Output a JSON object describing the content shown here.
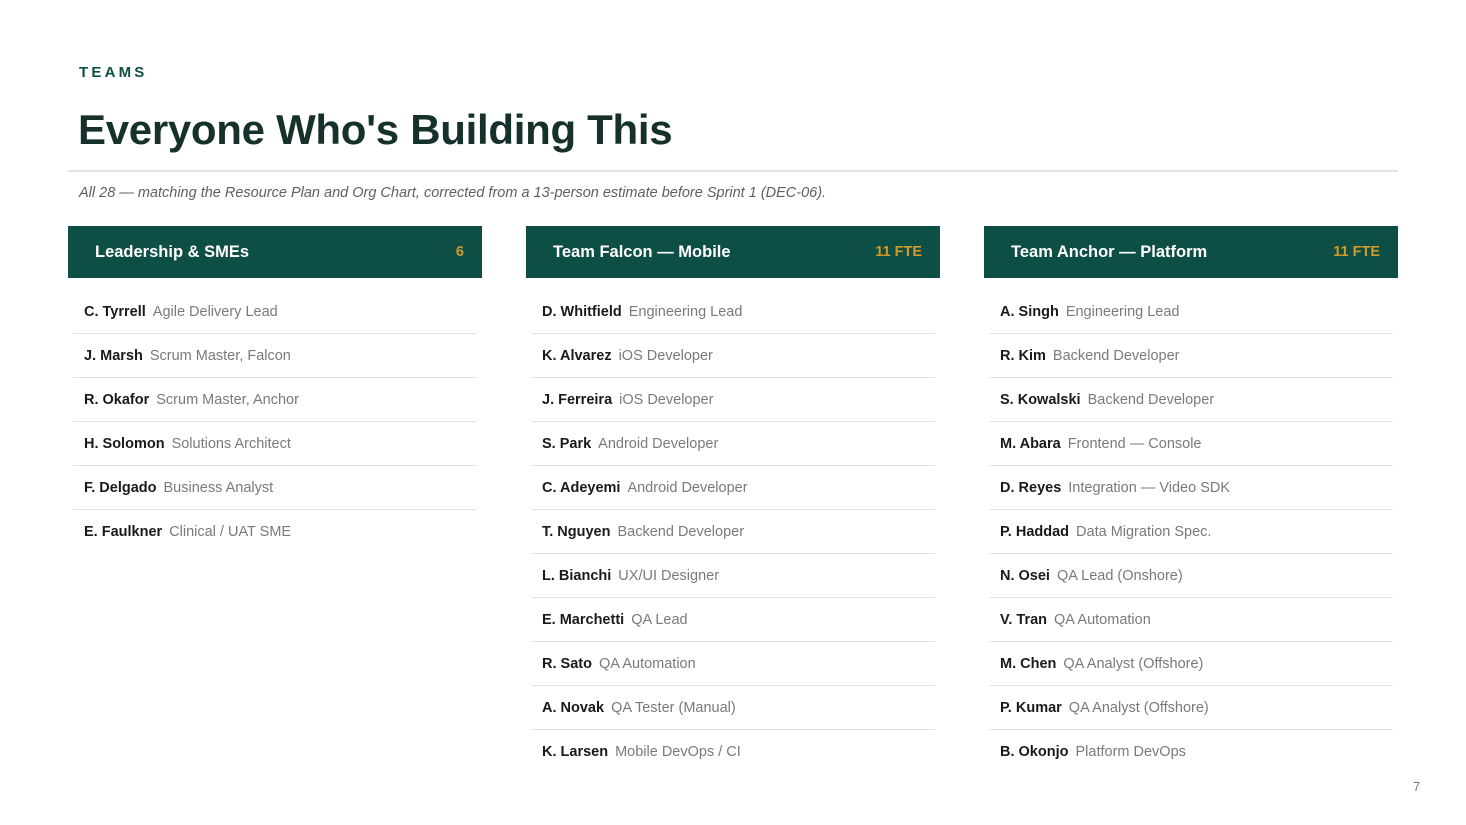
{
  "header": {
    "eyebrow": "TEAMS",
    "title": "Everyone Who's Building This",
    "subtitle": "All 28 — matching the Resource Plan and Org Chart, corrected from a 13-person estimate before Sprint 1 (DEC-06)."
  },
  "colors": {
    "header_bg": "#0d4f45",
    "count_accent": "#d19a2a"
  },
  "columns": [
    {
      "title": "Leadership & SMEs",
      "count": "6",
      "members": [
        {
          "name": "C. Tyrrell",
          "role": "Agile Delivery Lead"
        },
        {
          "name": "J. Marsh",
          "role": "Scrum Master, Falcon"
        },
        {
          "name": "R. Okafor",
          "role": "Scrum Master, Anchor"
        },
        {
          "name": "H. Solomon",
          "role": "Solutions Architect"
        },
        {
          "name": "F. Delgado",
          "role": "Business Analyst"
        },
        {
          "name": "E. Faulkner",
          "role": "Clinical / UAT SME"
        }
      ]
    },
    {
      "title": "Team Falcon — Mobile",
      "count": "11 FTE",
      "members": [
        {
          "name": "D. Whitfield",
          "role": "Engineering Lead"
        },
        {
          "name": "K. Alvarez",
          "role": "iOS Developer"
        },
        {
          "name": "J. Ferreira",
          "role": "iOS Developer"
        },
        {
          "name": "S. Park",
          "role": "Android Developer"
        },
        {
          "name": "C. Adeyemi",
          "role": "Android Developer"
        },
        {
          "name": "T. Nguyen",
          "role": "Backend Developer"
        },
        {
          "name": "L. Bianchi",
          "role": "UX/UI Designer"
        },
        {
          "name": "E. Marchetti",
          "role": "QA Lead"
        },
        {
          "name": "R. Sato",
          "role": "QA Automation"
        },
        {
          "name": "A. Novak",
          "role": "QA Tester (Manual)"
        },
        {
          "name": "K. Larsen",
          "role": "Mobile DevOps / CI"
        }
      ]
    },
    {
      "title": "Team Anchor — Platform",
      "count": "11 FTE",
      "members": [
        {
          "name": "A. Singh",
          "role": "Engineering Lead"
        },
        {
          "name": "R. Kim",
          "role": "Backend Developer"
        },
        {
          "name": "S. Kowalski",
          "role": "Backend Developer"
        },
        {
          "name": "M. Abara",
          "role": "Frontend — Console"
        },
        {
          "name": "D. Reyes",
          "role": "Integration — Video SDK"
        },
        {
          "name": "P. Haddad",
          "role": "Data Migration Spec."
        },
        {
          "name": "N. Osei",
          "role": "QA Lead (Onshore)"
        },
        {
          "name": "V. Tran",
          "role": "QA Automation"
        },
        {
          "name": "M. Chen",
          "role": "QA Analyst (Offshore)"
        },
        {
          "name": "P. Kumar",
          "role": "QA Analyst (Offshore)"
        },
        {
          "name": "B. Okonjo",
          "role": "Platform DevOps"
        }
      ]
    }
  ],
  "footer": {
    "page_number": "7"
  }
}
